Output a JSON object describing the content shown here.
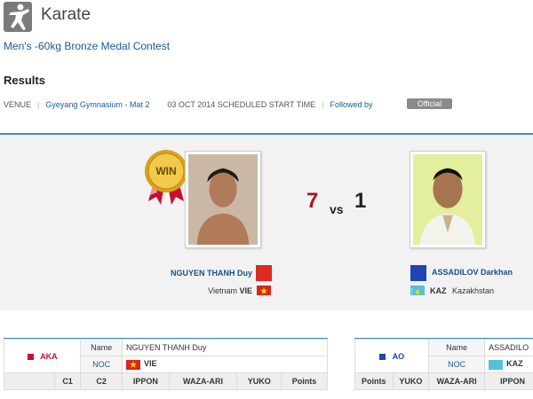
{
  "header": {
    "sport_title": "Karate",
    "event_title": "Men's -60kg Bronze Medal Contest",
    "results_heading": "Results"
  },
  "info": {
    "venue_label": "VENUE",
    "venue_name": "Gyeyang Gymnasium - Mat 2",
    "schedule_text": "03 OCT 2014 SCHEDULED START TIME",
    "followed_by": "Followed by",
    "status_badge": "Official"
  },
  "match": {
    "win_badge": "WIN",
    "score_left": "7",
    "vs": "vs",
    "score_right": "1",
    "left": {
      "name": "NGUYEN THANH Duy",
      "country": "Vietnam",
      "noc": "VIE"
    },
    "right": {
      "name": "ASSADILOV Darkhan",
      "country": "Kazakhstan",
      "noc": "KAZ"
    }
  },
  "table_left": {
    "corner": "AKA",
    "name_label": "Name",
    "name_value": "NGUYEN THANH Duy",
    "noc_label": "NOC",
    "noc_value": "VIE",
    "columns": [
      "C1",
      "C2",
      "IPPON",
      "WAZA-ARI",
      "YUKO",
      "Points"
    ]
  },
  "table_right": {
    "corner": "AO",
    "name_label": "Name",
    "name_value": "ASSADILO",
    "noc_label": "NOC",
    "noc_value": "KAZ",
    "columns": [
      "Points",
      "YUKO",
      "WAZA-ARI",
      "IPPON"
    ]
  },
  "colors": {
    "accent": "#3c8dc8",
    "aka": "#c8102e",
    "ao": "#1f45b5",
    "link": "#1a5a96"
  }
}
